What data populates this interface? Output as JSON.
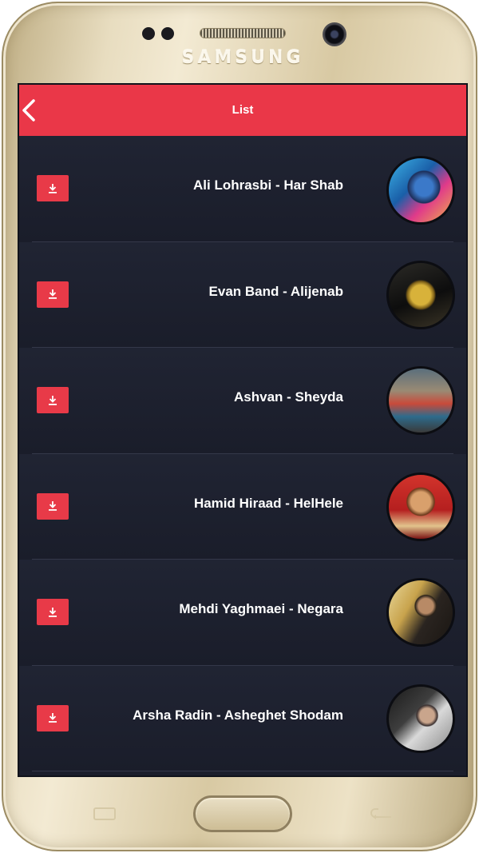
{
  "device": {
    "brand": "SAMSUNG"
  },
  "appbar": {
    "title": "List",
    "back_icon": "chevron-left-icon"
  },
  "colors": {
    "accent": "#ea3748",
    "background": "#1b1e2c",
    "text": "#ffffff"
  },
  "list": {
    "download_icon": "download-icon",
    "items": [
      {
        "title": "Ali Lohrasbi - Har Shab"
      },
      {
        "title": "Evan Band - Alijenab"
      },
      {
        "title": "Ashvan - Sheyda"
      },
      {
        "title": "Hamid Hiraad - HelHele"
      },
      {
        "title": "Mehdi Yaghmaei - Negara"
      },
      {
        "title": "Arsha Radin - Asheghet Shodam"
      }
    ]
  },
  "nav": {
    "recents_icon": "recents-icon",
    "home_icon": "home-button",
    "back_icon": "back-key-icon"
  }
}
